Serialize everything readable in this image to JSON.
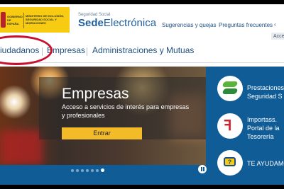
{
  "gov": {
    "gobierno": "GOBIERNO DE ESPAÑA",
    "ministerio": "MINISTERIO DE INCLUSIÓN, SEGURIDAD SOCIAL Y MIGRACIONES"
  },
  "sede": {
    "subtitle": "Seguridad Social",
    "title_bold": "Sede",
    "title_light": "Electrónica"
  },
  "top_links": [
    "Sugerencias y quejas",
    "Preguntas frecuentes"
  ],
  "access_label": "Acce",
  "nav": {
    "items": [
      "iudadanos",
      "Empresas",
      "Administraciones y Mutuas"
    ]
  },
  "hero": {
    "title": "Empresas",
    "description": "Acceso a servicios de interés para empresas y profesionales",
    "button": "Entrar",
    "slide_count": 7,
    "active_slide": 6
  },
  "side": {
    "items": [
      {
        "line1": "Prestaciones",
        "line2": "Seguridad S",
        "icon": "ss-logo-icon"
      },
      {
        "line1": "Importass.",
        "line2": "Portal de la",
        "line3": "Tesorería",
        "icon": "tesoreria-logo-icon"
      },
      {
        "line1": "TE AYUDAMO",
        "icon": "help-chat-icon"
      }
    ]
  },
  "colors": {
    "brand_blue": "#0f5c96",
    "accent_yellow": "#f4bb28",
    "gov_yellow": "#f6cb12",
    "annotation_red": "#c8102e"
  }
}
